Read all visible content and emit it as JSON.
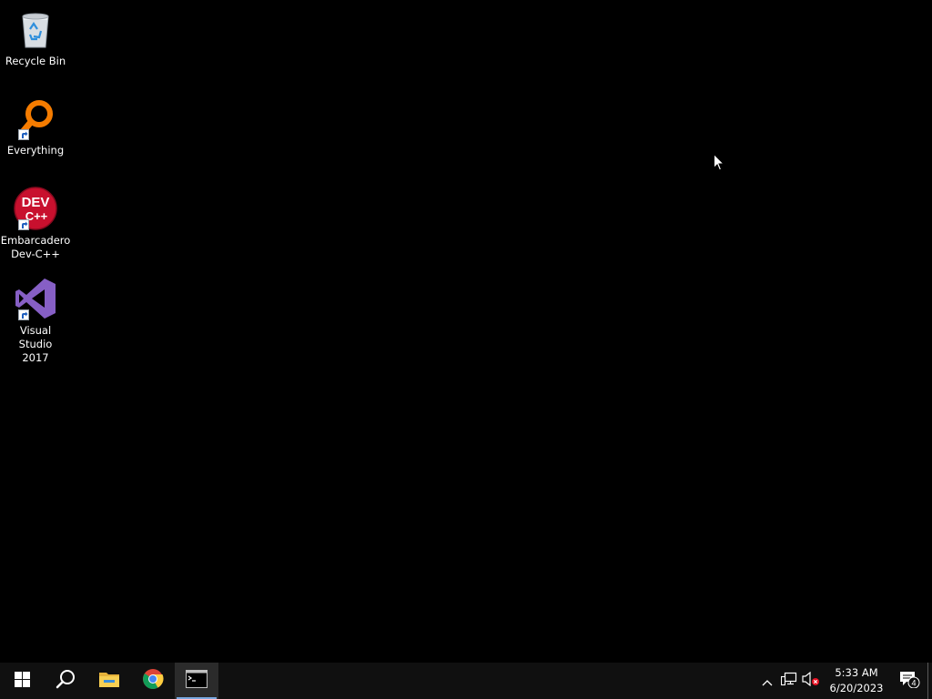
{
  "desktop": {
    "icons": [
      {
        "label": "Recycle Bin",
        "icon": "recycle-bin-icon"
      },
      {
        "label": "Everything",
        "icon": "everything-search-icon"
      },
      {
        "label": "Embarcadero\nDev-C++",
        "icon": "dev-cpp-icon",
        "icon_text_top": "DEV",
        "icon_text_bottom": "C++"
      },
      {
        "label": "Visual Studio\n2017",
        "icon": "visual-studio-icon"
      }
    ]
  },
  "taskbar": {
    "buttons": [
      {
        "icon": "windows-start-icon"
      },
      {
        "icon": "search-icon"
      },
      {
        "icon": "file-explorer-icon"
      },
      {
        "icon": "chrome-icon"
      },
      {
        "icon": "command-prompt-icon",
        "active": true
      }
    ],
    "tray": {
      "icons": [
        "chevron-up-icon",
        "network-icon",
        "volume-muted-icon"
      ],
      "time": "5:33 AM",
      "date": "6/20/2023",
      "notification_count": "4"
    }
  },
  "colors": {
    "desktop_bg": "#000000",
    "taskbar_bg": "#101010",
    "active_underline": "#7aa8e0"
  }
}
